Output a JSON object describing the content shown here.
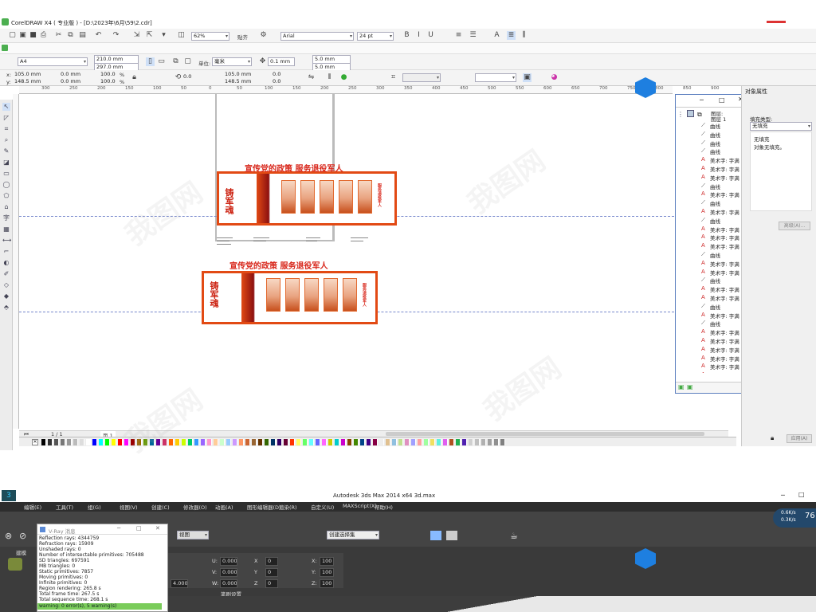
{
  "coreldraw": {
    "title": "CorelDRAW X4 ( 专业版 ) - [D:\\2023年\\6月\\59\\2.cdr]",
    "zoom": "62%",
    "snap": "贴齐",
    "font": "Arial",
    "font_size": "24 pt",
    "page_size": "A4",
    "width": "210.0 mm",
    "height": "297.0 mm",
    "unit_label": "单位:",
    "unit": "毫米",
    "nudge": "0.1 mm",
    "dup_x": "5.0 mm",
    "dup_y": "5.0 mm",
    "x_pos": "105.0 mm",
    "y_pos": "148.5 mm",
    "w0": "0.0 mm",
    "h0": "0.0 mm",
    "scale_x": "100.0",
    "scale_y": "100.0",
    "pct": "%",
    "angle": "0.0",
    "cx": "105.0 mm",
    "cy": "148.5 mm",
    "v1": "0.0",
    "v2": "0.0",
    "page_counter": "1 / 1",
    "page_tab": "页 1",
    "ruler_ticks": [
      "300",
      "250",
      "200",
      "150",
      "100",
      "50",
      "0",
      "50",
      "100",
      "150",
      "200",
      "250",
      "300",
      "350",
      "400",
      "450",
      "500",
      "550",
      "600",
      "650",
      "700",
      "750",
      "800",
      "850",
      "900"
    ],
    "docker_title": "对象属性",
    "fill_type_label": "填充类型:",
    "fill_type": "无填充",
    "fill_none": "无填充",
    "fill_desc": "对象无填充。",
    "advanced_btn": "高级(A)...",
    "apply_btn": "应用(A)",
    "obj_manager": {
      "layer_label": "图层:",
      "layer_value": "图层 1",
      "rows": [
        "曲线",
        "曲线",
        "曲线",
        "曲线",
        "美术字: 字满",
        "美术字: 字满",
        "美术字: 字满",
        "曲线",
        "美术字: 字满",
        "曲线",
        "美术字: 字满",
        "曲线",
        "美术字: 字满",
        "美术字: 字满",
        "美术字: 字满",
        "曲线",
        "美术字: 字满",
        "美术字: 字满",
        "曲线",
        "美术字: 字满",
        "美术字: 字满",
        "曲线",
        "美术字: 字满",
        "曲线",
        "美术字: 字满",
        "美术字: 字满",
        "美术字: 字满",
        "美术字: 字满",
        "美术字: 字满",
        "美术字: 字满",
        "美术字: 字满"
      ]
    },
    "banner_top": {
      "headline": "宣传党的政策  服务退役军人",
      "left_text": "铸军魂",
      "panel_caption": "服务退役军人"
    },
    "banner_bottom": {
      "headline": "宣传党的政策  服务退役军人",
      "left_text": "铸军魂",
      "panel_caption": "服务退役军人"
    },
    "palette": [
      "#000000",
      "#333333",
      "#555555",
      "#777777",
      "#999999",
      "#bbbbbb",
      "#dddddd",
      "#ffffff",
      "#0000ff",
      "#00ffff",
      "#00ff00",
      "#ffff00",
      "#ff0000",
      "#ff00ff",
      "#990000",
      "#996600",
      "#669900",
      "#006699",
      "#660099",
      "#cc3366",
      "#ff6600",
      "#ffcc00",
      "#ccff00",
      "#00cc66",
      "#3399ff",
      "#9966ff",
      "#ff99cc",
      "#ffcc99",
      "#ccffcc",
      "#99ccff",
      "#cc99ff",
      "#ff9966",
      "#cc6633",
      "#996633",
      "#663300",
      "#336600",
      "#003366",
      "#330066",
      "#660033",
      "#ff3300",
      "#ffff66",
      "#66ff66",
      "#66ffff",
      "#6666ff",
      "#ff66ff",
      "#cccc00",
      "#00cccc",
      "#cc00cc",
      "#884400",
      "#448800",
      "#004488",
      "#440088",
      "#880044",
      "#eeeeee",
      "#e0c090",
      "#90c0e0",
      "#c0e090",
      "#e090c0",
      "#a0a0ff",
      "#ffa0a0",
      "#a0ffa0",
      "#f0e060",
      "#60f0e0",
      "#e060f0",
      "#b05020",
      "#20b050",
      "#5020b0",
      "#d0d0d0",
      "#c0c0c0",
      "#b0b0b0",
      "#a0a0a0",
      "#909090",
      "#808080"
    ],
    "accent": "#e24a14"
  },
  "max": {
    "title": "Autodesk 3ds Max  2014 x64        3d.max",
    "menu": [
      "编辑(E)",
      "工具(T)",
      "组(G)",
      "视图(V)",
      "创建(C)",
      "修改器(O)",
      "动画(A)",
      "图形编辑器(D)",
      "渲染(R)",
      "自定义(U)",
      "MAXScript(X)",
      "帮助(H)"
    ],
    "viewport_select": "视图",
    "selection_set": "创建选择集",
    "panel_tab": "建模",
    "render_setup": "笔刷设置",
    "net_up": "0.6K/s",
    "net_down": "0.3K/s",
    "net_pct": "76",
    "fields": {
      "u": "0.000",
      "v": "0.000",
      "w": "0.000",
      "x1": "0",
      "y1": "0",
      "z1": "0",
      "x2": "100",
      "y2": "100",
      "z2": "100",
      "four": "4.000"
    },
    "vray": {
      "title": "V-Ray 消息",
      "lines": [
        "Reflection rays: 4344759",
        "Refraction rays: 15909",
        "Unshaded rays: 0",
        "Number of intersectable primitives: 705488",
        "SD triangles: 697591",
        "MB triangles: 0",
        "Static primitives: 7857",
        "Moving primitives: 0",
        "Infinite primitives: 0",
        "Region rendering: 265.8 s",
        "Total frame time: 267.5 s",
        "Total sequence time: 268.1 s"
      ],
      "status": "warning: 0 error(s), 5 warning(s)"
    }
  }
}
